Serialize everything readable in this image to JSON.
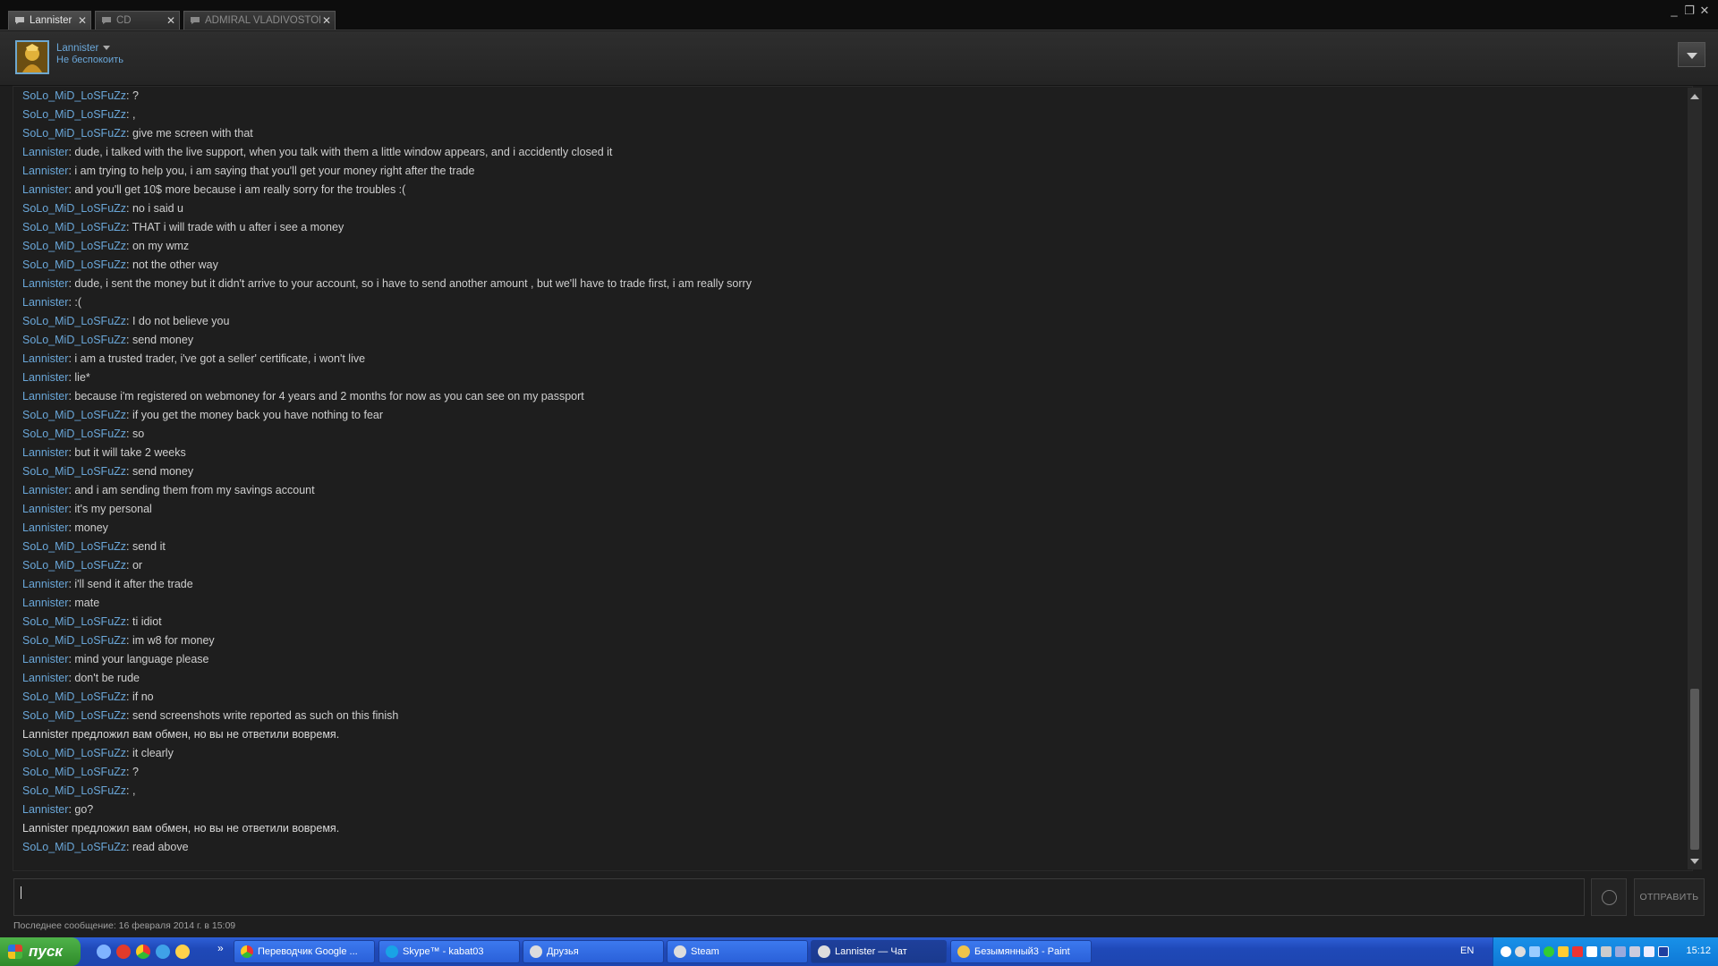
{
  "tabs": [
    {
      "label": "Lannister",
      "active": true
    },
    {
      "label": "CD",
      "active": false
    },
    {
      "label": "ADMIRAL VLADIVOSTOK",
      "active": false
    }
  ],
  "header": {
    "username": "Lannister",
    "status": "Не беспокоить"
  },
  "messages": [
    {
      "nick": "SoLo_MiD_LoSFuZz",
      "text": "?"
    },
    {
      "nick": "SoLo_MiD_LoSFuZz",
      "text": ","
    },
    {
      "nick": "SoLo_MiD_LoSFuZz",
      "text": "give me screen with that"
    },
    {
      "nick": "Lannister",
      "text": "dude, i talked with the live support, when you talk with them a little window appears, and i accidently closed it"
    },
    {
      "nick": "Lannister",
      "text": "i am trying to help you, i am saying that you'll get your money right after the trade"
    },
    {
      "nick": "Lannister",
      "text": "and you'll get 10$ more because i am really sorry for the troubles :("
    },
    {
      "nick": "SoLo_MiD_LoSFuZz",
      "text": "no i said u"
    },
    {
      "nick": "SoLo_MiD_LoSFuZz",
      "text": "THAT i will trade with u after i see a money"
    },
    {
      "nick": "SoLo_MiD_LoSFuZz",
      "text": "on my wmz"
    },
    {
      "nick": "SoLo_MiD_LoSFuZz",
      "text": "not the other way"
    },
    {
      "nick": "Lannister",
      "text": "dude, i sent the money but it didn't arrive to your account, so i have to send another amount , but we'll have to trade first, i am really sorry"
    },
    {
      "nick": "Lannister",
      "text": ":("
    },
    {
      "nick": "SoLo_MiD_LoSFuZz",
      "text": "I do not believe you"
    },
    {
      "nick": "SoLo_MiD_LoSFuZz",
      "text": "send money"
    },
    {
      "nick": "Lannister",
      "text": "i am a trusted trader, i've got a seller' certificate, i won't live"
    },
    {
      "nick": "Lannister",
      "text": "lie*"
    },
    {
      "nick": "Lannister",
      "text": "because i'm registered on webmoney for 4 years and 2 months for now as you can see on my passport"
    },
    {
      "nick": "SoLo_MiD_LoSFuZz",
      "text": "if you get the money back you have nothing to fear"
    },
    {
      "nick": "SoLo_MiD_LoSFuZz",
      "text": "so"
    },
    {
      "nick": "Lannister",
      "text": "but it will take 2 weeks"
    },
    {
      "nick": "SoLo_MiD_LoSFuZz",
      "text": "send money"
    },
    {
      "nick": "Lannister",
      "text": "and i am sending them from my savings account"
    },
    {
      "nick": "Lannister",
      "text": "it's my personal"
    },
    {
      "nick": "Lannister",
      "text": "money"
    },
    {
      "nick": "SoLo_MiD_LoSFuZz",
      "text": "send it"
    },
    {
      "nick": "SoLo_MiD_LoSFuZz",
      "text": "or"
    },
    {
      "nick": "Lannister",
      "text": "i'll send it after the trade"
    },
    {
      "nick": "Lannister",
      "text": "mate"
    },
    {
      "nick": "SoLo_MiD_LoSFuZz",
      "text": "ti idiot"
    },
    {
      "nick": "SoLo_MiD_LoSFuZz",
      "text": "im w8 for money"
    },
    {
      "nick": "Lannister",
      "text": "mind your language please"
    },
    {
      "nick": "Lannister",
      "text": "don't be rude"
    },
    {
      "nick": "SoLo_MiD_LoSFuZz",
      "text": "if no"
    },
    {
      "nick": "SoLo_MiD_LoSFuZz",
      "text": "send screenshots write reported as such on this finish"
    },
    {
      "system": "Lannister предложил вам обмен, но вы не ответили вовремя."
    },
    {
      "nick": "SoLo_MiD_LoSFuZz",
      "text": "it clearly"
    },
    {
      "nick": "SoLo_MiD_LoSFuZz",
      "text": "?"
    },
    {
      "nick": "SoLo_MiD_LoSFuZz",
      "text": ","
    },
    {
      "nick": "Lannister",
      "text": "go?"
    },
    {
      "system": "Lannister предложил вам обмен, но вы не ответили вовремя."
    },
    {
      "nick": "SoLo_MiD_LoSFuZz",
      "text": "read above"
    }
  ],
  "input": {
    "value": ""
  },
  "send_label": "ОТПРАВИТЬ",
  "footer_status": "Последнее сообщение: 16 февраля 2014 г. в 15:09",
  "taskbar": {
    "start_label": "пуск",
    "tasks": [
      {
        "label": "Переводчик Google ...",
        "icon": "chrome-icon"
      },
      {
        "label": "Skype™ - kabat03",
        "icon": "skype-icon"
      },
      {
        "label": "Друзья",
        "icon": "steam-icon"
      },
      {
        "label": "Steam",
        "icon": "steam-icon"
      },
      {
        "label": "Lannister — Чат",
        "icon": "steam-icon",
        "active": true
      },
      {
        "label": "Безымянный3 - Paint",
        "icon": "paint-icon"
      }
    ],
    "language": "EN",
    "clock": "15:12"
  },
  "colors": {
    "nick": "#6aa7d9",
    "text": "#cfcfcf",
    "background": "#1e1e1e",
    "taskbar": "#245edb",
    "start": "#3c9a37"
  }
}
